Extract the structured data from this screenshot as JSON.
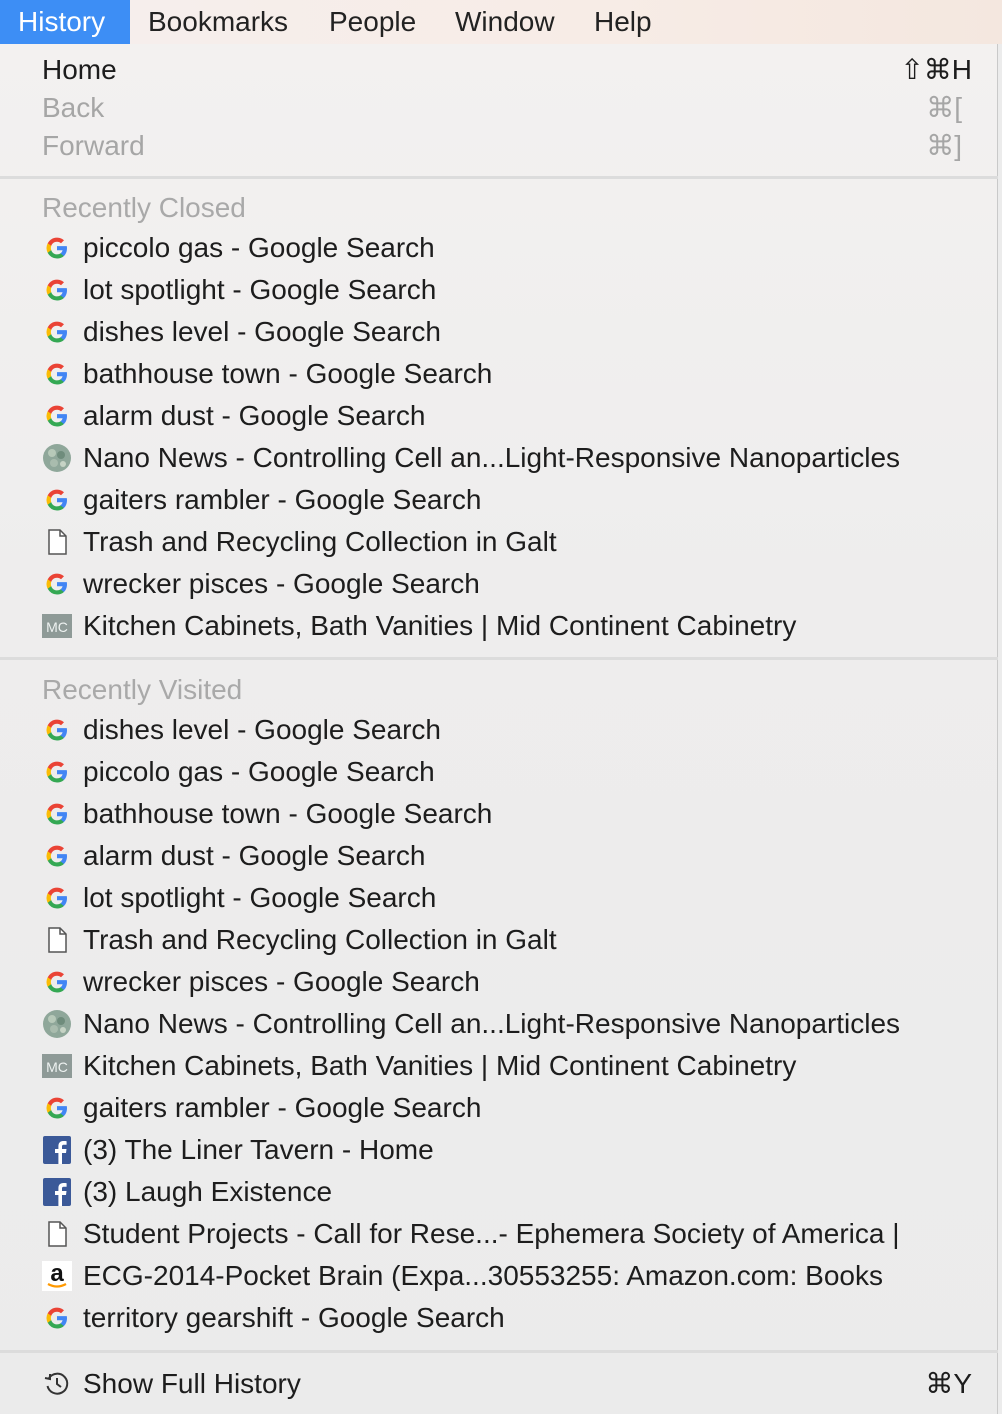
{
  "menubar": {
    "items": [
      "History",
      "Bookmarks",
      "People",
      "Window",
      "Help"
    ]
  },
  "nav": {
    "home": {
      "label": "Home",
      "shortcut": "⇧⌘H"
    },
    "back": {
      "label": "Back",
      "shortcut": "⌘["
    },
    "forward": {
      "label": "Forward",
      "shortcut": "⌘]"
    }
  },
  "recently_closed": {
    "header": "Recently Closed",
    "items": [
      {
        "icon": "google-icon",
        "label": "piccolo gas - Google Search"
      },
      {
        "icon": "google-icon",
        "label": "lot spotlight - Google Search"
      },
      {
        "icon": "google-icon",
        "label": "dishes level - Google Search"
      },
      {
        "icon": "google-icon",
        "label": "bathhouse town - Google Search"
      },
      {
        "icon": "google-icon",
        "label": "alarm dust - Google Search"
      },
      {
        "icon": "nano-news-icon",
        "label": "Nano News - Controlling Cell an...Light-Responsive Nanoparticles"
      },
      {
        "icon": "google-icon",
        "label": "gaiters rambler - Google Search"
      },
      {
        "icon": "page-icon",
        "label": "Trash and Recycling Collection in Galt"
      },
      {
        "icon": "google-icon",
        "label": "wrecker pisces - Google Search"
      },
      {
        "icon": "mc-icon",
        "label": "Kitchen Cabinets, Bath Vanities | Mid Continent Cabinetry"
      }
    ]
  },
  "recently_visited": {
    "header": "Recently Visited",
    "items": [
      {
        "icon": "google-icon",
        "label": "dishes level - Google Search"
      },
      {
        "icon": "google-icon",
        "label": "piccolo gas - Google Search"
      },
      {
        "icon": "google-icon",
        "label": "bathhouse town - Google Search"
      },
      {
        "icon": "google-icon",
        "label": "alarm dust - Google Search"
      },
      {
        "icon": "google-icon",
        "label": "lot spotlight - Google Search"
      },
      {
        "icon": "page-icon",
        "label": "Trash and Recycling Collection in Galt"
      },
      {
        "icon": "google-icon",
        "label": "wrecker pisces - Google Search"
      },
      {
        "icon": "nano-news-icon",
        "label": "Nano News - Controlling Cell an...Light-Responsive Nanoparticles"
      },
      {
        "icon": "mc-icon",
        "label": "Kitchen Cabinets, Bath Vanities | Mid Continent Cabinetry"
      },
      {
        "icon": "google-icon",
        "label": "gaiters rambler - Google Search"
      },
      {
        "icon": "facebook-icon",
        "label": "(3) The Liner Tavern - Home"
      },
      {
        "icon": "facebook-icon",
        "label": "(3) Laugh Existence"
      },
      {
        "icon": "page-icon",
        "label": "Student Projects - Call for Rese...- Ephemera Society of America |"
      },
      {
        "icon": "amazon-icon",
        "label": "ECG-2014-Pocket Brain (Expa...30553255: Amazon.com: Books"
      },
      {
        "icon": "google-icon",
        "label": "territory gearshift - Google Search"
      }
    ]
  },
  "footer": {
    "icon": "history-clock-icon",
    "label": "Show Full History",
    "shortcut": "⌘Y"
  },
  "colors": {
    "accent": "#3d8ef5",
    "disabled": "#a6a6a6"
  }
}
